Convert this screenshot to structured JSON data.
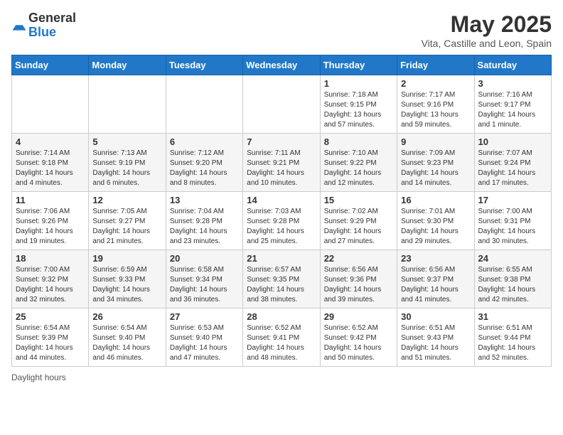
{
  "header": {
    "logo_general": "General",
    "logo_blue": "Blue",
    "month_title": "May 2025",
    "location": "Vita, Castille and Leon, Spain"
  },
  "days_of_week": [
    "Sunday",
    "Monday",
    "Tuesday",
    "Wednesday",
    "Thursday",
    "Friday",
    "Saturday"
  ],
  "weeks": [
    [
      {
        "day": "",
        "info": ""
      },
      {
        "day": "",
        "info": ""
      },
      {
        "day": "",
        "info": ""
      },
      {
        "day": "",
        "info": ""
      },
      {
        "day": "1",
        "info": "Sunrise: 7:18 AM\nSunset: 9:15 PM\nDaylight: 13 hours and 57 minutes."
      },
      {
        "day": "2",
        "info": "Sunrise: 7:17 AM\nSunset: 9:16 PM\nDaylight: 13 hours and 59 minutes."
      },
      {
        "day": "3",
        "info": "Sunrise: 7:16 AM\nSunset: 9:17 PM\nDaylight: 14 hours and 1 minute."
      }
    ],
    [
      {
        "day": "4",
        "info": "Sunrise: 7:14 AM\nSunset: 9:18 PM\nDaylight: 14 hours and 4 minutes."
      },
      {
        "day": "5",
        "info": "Sunrise: 7:13 AM\nSunset: 9:19 PM\nDaylight: 14 hours and 6 minutes."
      },
      {
        "day": "6",
        "info": "Sunrise: 7:12 AM\nSunset: 9:20 PM\nDaylight: 14 hours and 8 minutes."
      },
      {
        "day": "7",
        "info": "Sunrise: 7:11 AM\nSunset: 9:21 PM\nDaylight: 14 hours and 10 minutes."
      },
      {
        "day": "8",
        "info": "Sunrise: 7:10 AM\nSunset: 9:22 PM\nDaylight: 14 hours and 12 minutes."
      },
      {
        "day": "9",
        "info": "Sunrise: 7:09 AM\nSunset: 9:23 PM\nDaylight: 14 hours and 14 minutes."
      },
      {
        "day": "10",
        "info": "Sunrise: 7:07 AM\nSunset: 9:24 PM\nDaylight: 14 hours and 17 minutes."
      }
    ],
    [
      {
        "day": "11",
        "info": "Sunrise: 7:06 AM\nSunset: 9:26 PM\nDaylight: 14 hours and 19 minutes."
      },
      {
        "day": "12",
        "info": "Sunrise: 7:05 AM\nSunset: 9:27 PM\nDaylight: 14 hours and 21 minutes."
      },
      {
        "day": "13",
        "info": "Sunrise: 7:04 AM\nSunset: 9:28 PM\nDaylight: 14 hours and 23 minutes."
      },
      {
        "day": "14",
        "info": "Sunrise: 7:03 AM\nSunset: 9:28 PM\nDaylight: 14 hours and 25 minutes."
      },
      {
        "day": "15",
        "info": "Sunrise: 7:02 AM\nSunset: 9:29 PM\nDaylight: 14 hours and 27 minutes."
      },
      {
        "day": "16",
        "info": "Sunrise: 7:01 AM\nSunset: 9:30 PM\nDaylight: 14 hours and 29 minutes."
      },
      {
        "day": "17",
        "info": "Sunrise: 7:00 AM\nSunset: 9:31 PM\nDaylight: 14 hours and 30 minutes."
      }
    ],
    [
      {
        "day": "18",
        "info": "Sunrise: 7:00 AM\nSunset: 9:32 PM\nDaylight: 14 hours and 32 minutes."
      },
      {
        "day": "19",
        "info": "Sunrise: 6:59 AM\nSunset: 9:33 PM\nDaylight: 14 hours and 34 minutes."
      },
      {
        "day": "20",
        "info": "Sunrise: 6:58 AM\nSunset: 9:34 PM\nDaylight: 14 hours and 36 minutes."
      },
      {
        "day": "21",
        "info": "Sunrise: 6:57 AM\nSunset: 9:35 PM\nDaylight: 14 hours and 38 minutes."
      },
      {
        "day": "22",
        "info": "Sunrise: 6:56 AM\nSunset: 9:36 PM\nDaylight: 14 hours and 39 minutes."
      },
      {
        "day": "23",
        "info": "Sunrise: 6:56 AM\nSunset: 9:37 PM\nDaylight: 14 hours and 41 minutes."
      },
      {
        "day": "24",
        "info": "Sunrise: 6:55 AM\nSunset: 9:38 PM\nDaylight: 14 hours and 42 minutes."
      }
    ],
    [
      {
        "day": "25",
        "info": "Sunrise: 6:54 AM\nSunset: 9:39 PM\nDaylight: 14 hours and 44 minutes."
      },
      {
        "day": "26",
        "info": "Sunrise: 6:54 AM\nSunset: 9:40 PM\nDaylight: 14 hours and 46 minutes."
      },
      {
        "day": "27",
        "info": "Sunrise: 6:53 AM\nSunset: 9:40 PM\nDaylight: 14 hours and 47 minutes."
      },
      {
        "day": "28",
        "info": "Sunrise: 6:52 AM\nSunset: 9:41 PM\nDaylight: 14 hours and 48 minutes."
      },
      {
        "day": "29",
        "info": "Sunrise: 6:52 AM\nSunset: 9:42 PM\nDaylight: 14 hours and 50 minutes."
      },
      {
        "day": "30",
        "info": "Sunrise: 6:51 AM\nSunset: 9:43 PM\nDaylight: 14 hours and 51 minutes."
      },
      {
        "day": "31",
        "info": "Sunrise: 6:51 AM\nSunset: 9:44 PM\nDaylight: 14 hours and 52 minutes."
      }
    ]
  ],
  "footer": "Daylight hours"
}
